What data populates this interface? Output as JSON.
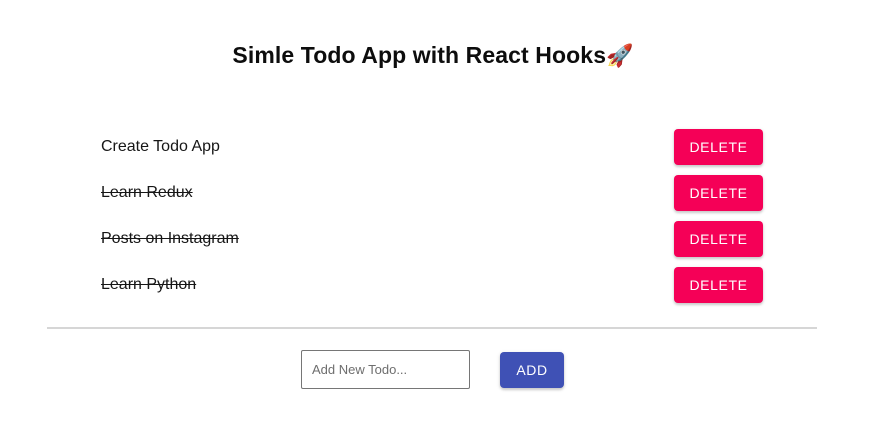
{
  "header": {
    "title": "Simle Todo App with React Hooks",
    "title_emoji": "🚀"
  },
  "todos": [
    {
      "text": "Create Todo App",
      "completed": false,
      "delete_label": "DELETE"
    },
    {
      "text": "Learn Redux",
      "completed": true,
      "delete_label": "DELETE"
    },
    {
      "text": "Posts on Instagram",
      "completed": true,
      "delete_label": "DELETE"
    },
    {
      "text": "Learn Python",
      "completed": true,
      "delete_label": "DELETE"
    }
  ],
  "form": {
    "input_placeholder": "Add New Todo...",
    "input_value": "",
    "add_label": "ADD"
  },
  "colors": {
    "delete_button": "#f50057",
    "add_button": "#3f51b5",
    "divider": "#d6d6d6"
  }
}
